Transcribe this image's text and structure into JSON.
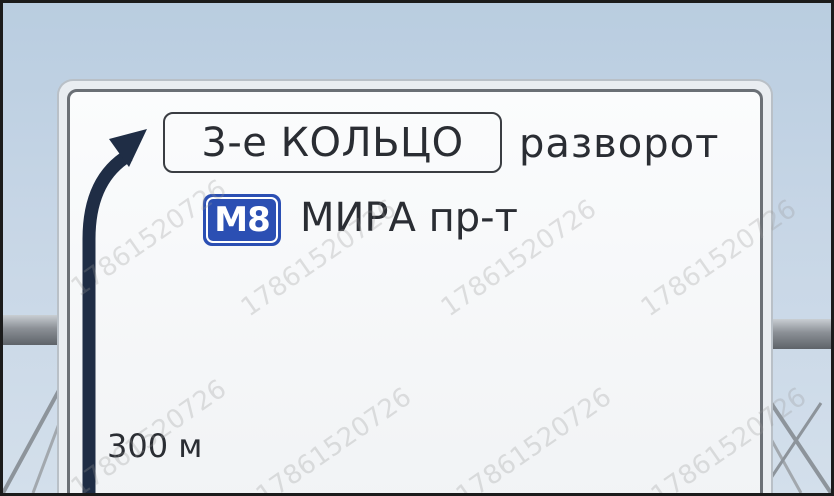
{
  "sign": {
    "ring_label": "3-е КОЛЬЦО",
    "uturn_label": "разворот",
    "route_number": "M8",
    "street_label": "МИРА пр-т",
    "distance_label": "300 м"
  },
  "watermark": "17861520726",
  "colors": {
    "sky": "#c7d6e6",
    "sign_background": "#f6f7f9",
    "sign_border": "#6b7076",
    "text": "#2a2d33",
    "route_badge": "#2b4fb3",
    "arrow": "#1f2d45"
  },
  "icons": {
    "arrow": "arrow-up-curved-right-icon"
  }
}
